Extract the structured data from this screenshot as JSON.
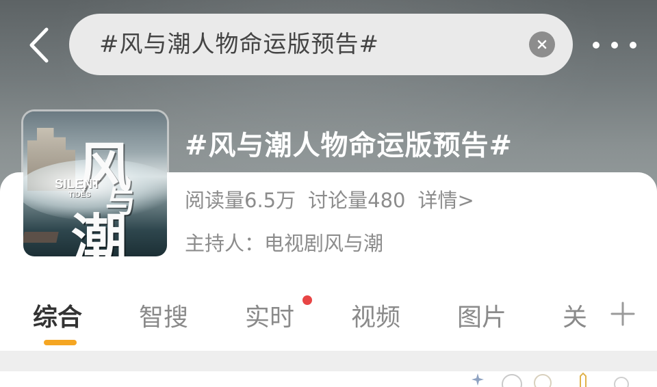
{
  "search": {
    "query": "#风与潮人物命运版预告#"
  },
  "topic": {
    "title": "#风与潮人物命运版预告#",
    "reads": "阅读量6.5万",
    "discussions": "讨论量480",
    "details_link": "详情>",
    "host": "主持人：电视剧风与潮"
  },
  "cover": {
    "title_char_1": "风",
    "title_char_2": "与",
    "title_char_3": "潮",
    "en_title_1": "SILENT",
    "en_title_2": "TIDES"
  },
  "tabs": [
    {
      "label": "综合",
      "active": true
    },
    {
      "label": "智搜"
    },
    {
      "label": "实时",
      "has_dot": true
    },
    {
      "label": "视频"
    },
    {
      "label": "图片"
    },
    {
      "label": "关"
    }
  ],
  "colors": {
    "accent": "#f5a623",
    "notification_dot": "#e84545",
    "muted_text": "#8c8c8c"
  },
  "icons": [
    "back-icon",
    "clear-icon",
    "more-icon",
    "plus-icon"
  ]
}
